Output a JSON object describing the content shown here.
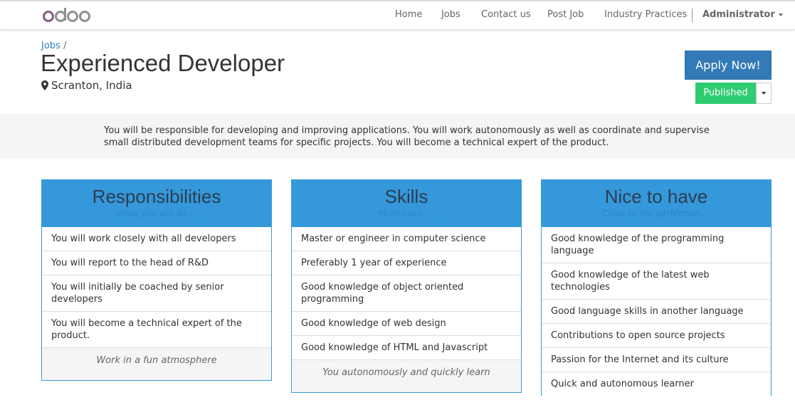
{
  "brand": {
    "logo_text": "odoo",
    "logo_color": "#875a7b"
  },
  "nav": {
    "items": [
      "Home",
      "Jobs",
      "Contact us",
      "Post Job",
      "Industry Practices"
    ],
    "user": "Administrator"
  },
  "breadcrumb": {
    "link": "Jobs",
    "separator": "/"
  },
  "job": {
    "title": "Experienced Developer",
    "location": "Scranton, India",
    "location_icon": "map-marker-icon"
  },
  "actions": {
    "apply": "Apply Now!",
    "status": "Published"
  },
  "intro": "You will be responsible for developing and improving applications. You will work autonomously as well as coordinate and supervise small distributed development teams for specific projects. You will become a technical expert of the product.",
  "cards": [
    {
      "title": "Responsibilities",
      "subtitle": "What you will do ...",
      "items": [
        "You will work closely with all developers",
        "You will report to the head of R&D",
        "You will initially be coached by senior developers",
        "You will become a technical expert of the product."
      ],
      "footer": "Work in a fun atmosphere"
    },
    {
      "title": "Skills",
      "subtitle": "Must have ...",
      "items": [
        "Master or engineer in computer science",
        "Preferably 1 year of experience",
        "Good knowledge of object oriented programming",
        "Good knowledge of web design",
        "Good knowledge of HTML and Javascript"
      ],
      "footer": "You autonomously and quickly learn"
    },
    {
      "title": "Nice to have",
      "subtitle": "Close to the perfection ...",
      "items": [
        "Good knowledge of the programming language",
        "Good knowledge of the latest web technologies",
        "Good language skills in another language",
        "Contributions to open source projects",
        "Passion for the Internet and its culture",
        "Quick and autonomous learner"
      ]
    }
  ],
  "colors": {
    "primary": "#337ab7",
    "published": "#2ecc71",
    "card_header": "#3498db"
  }
}
